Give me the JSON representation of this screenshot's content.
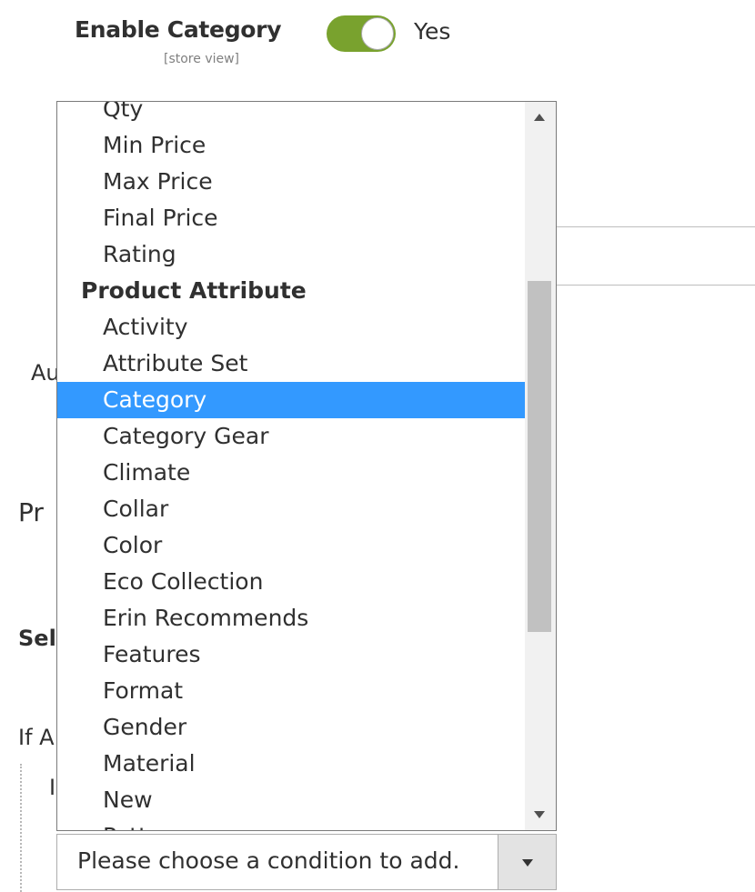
{
  "enable_category": {
    "label": "Enable Category",
    "scope": "[store view]",
    "toggle_value": "Yes",
    "toggle_on": true,
    "toggle_color": "#79a22e"
  },
  "background_fragments": {
    "au": "Au",
    "pr": "Pr",
    "sel": "Sel",
    "if_a": "If A",
    "i": "I"
  },
  "dropdown": {
    "items": [
      {
        "label": "Qty",
        "type": "option"
      },
      {
        "label": "Min Price",
        "type": "option"
      },
      {
        "label": "Max Price",
        "type": "option"
      },
      {
        "label": "Final Price",
        "type": "option"
      },
      {
        "label": "Rating",
        "type": "option"
      },
      {
        "label": "Product Attribute",
        "type": "group"
      },
      {
        "label": "Activity",
        "type": "option"
      },
      {
        "label": "Attribute Set",
        "type": "option"
      },
      {
        "label": "Category",
        "type": "option",
        "selected": true
      },
      {
        "label": "Category Gear",
        "type": "option"
      },
      {
        "label": "Climate",
        "type": "option"
      },
      {
        "label": "Collar",
        "type": "option"
      },
      {
        "label": "Color",
        "type": "option"
      },
      {
        "label": "Eco Collection",
        "type": "option"
      },
      {
        "label": "Erin Recommends",
        "type": "option"
      },
      {
        "label": "Features",
        "type": "option"
      },
      {
        "label": "Format",
        "type": "option"
      },
      {
        "label": "Gender",
        "type": "option"
      },
      {
        "label": "Material",
        "type": "option"
      },
      {
        "label": "New",
        "type": "option"
      },
      {
        "label": "Pattern",
        "type": "option"
      }
    ],
    "highlight_color": "#3399ff"
  },
  "condition_select": {
    "placeholder": "Please choose a condition to add."
  }
}
